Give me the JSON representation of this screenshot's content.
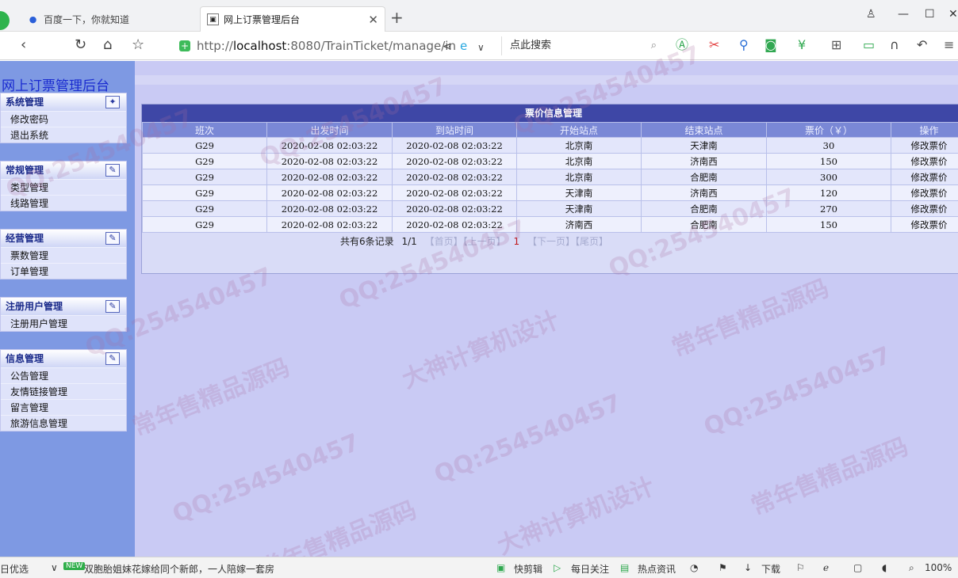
{
  "browser": {
    "tabs": [
      {
        "label": "百度一下，你就知道",
        "icon": "paw-icon"
      },
      {
        "label": "网上订票管理后台",
        "icon": "page-icon"
      }
    ],
    "new_tab": "+",
    "url_prefix": "http://",
    "url_host": "localhost",
    "url_rest": ":8080/TrainTicket/manage/in",
    "search_placeholder": "点此搜索"
  },
  "site": {
    "title": "网上订票管理后台"
  },
  "sidebar": {
    "groups": [
      {
        "title": "系统管理",
        "items": [
          "修改密码",
          "退出系统"
        ]
      },
      {
        "title": "常规管理",
        "items": [
          "类型管理",
          "线路管理"
        ]
      },
      {
        "title": "经营管理",
        "items": [
          "票数管理",
          "订单管理"
        ]
      },
      {
        "title": "注册用户管理",
        "items": [
          "注册用户管理"
        ]
      },
      {
        "title": "信息管理",
        "items": [
          "公告管理",
          "友情链接管理",
          "留言管理",
          "旅游信息管理"
        ]
      }
    ]
  },
  "panel": {
    "title": "票价信息管理",
    "columns": [
      "班次",
      "出发时间",
      "到站时间",
      "开始站点",
      "结束站点",
      "票价（￥）",
      "操作"
    ],
    "rows": [
      [
        "G29",
        "2020-02-08 02:03:22",
        "2020-02-08 02:03:22",
        "北京南",
        "天津南",
        "30",
        "修改票价"
      ],
      [
        "G29",
        "2020-02-08 02:03:22",
        "2020-02-08 02:03:22",
        "北京南",
        "济南西",
        "150",
        "修改票价"
      ],
      [
        "G29",
        "2020-02-08 02:03:22",
        "2020-02-08 02:03:22",
        "北京南",
        "合肥南",
        "300",
        "修改票价"
      ],
      [
        "G29",
        "2020-02-08 02:03:22",
        "2020-02-08 02:03:22",
        "天津南",
        "济南西",
        "120",
        "修改票价"
      ],
      [
        "G29",
        "2020-02-08 02:03:22",
        "2020-02-08 02:03:22",
        "天津南",
        "合肥南",
        "270",
        "修改票价"
      ],
      [
        "G29",
        "2020-02-08 02:03:22",
        "2020-02-08 02:03:22",
        "济南西",
        "合肥南",
        "150",
        "修改票价"
      ]
    ],
    "pager": {
      "summary": "共有6条记录",
      "pages": "1/1",
      "first": "【首页】",
      "prev": "【上一页】",
      "current": "1",
      "next": "【下一页】",
      "last": "【尾页】"
    }
  },
  "watermarks": [
    "QQ:254540457",
    "常年售精品源码",
    "大神计算机设计"
  ],
  "statusbar": {
    "left": "日优选",
    "news_tag": "NEW",
    "news": "双胞胎姐妹花嫁给同个新郎，一人陪嫁一套房",
    "items": [
      "快剪辑",
      "每日关注",
      "热点资讯",
      "下载"
    ],
    "zoom": "100%"
  },
  "colors": {
    "sidebar": "#7e99e3",
    "content": "#c9caf4",
    "panel_title": "#3e47a6",
    "header_row": "#7a88d6",
    "site_title": "#1a2bd0",
    "pager_current": "#c0181a"
  }
}
